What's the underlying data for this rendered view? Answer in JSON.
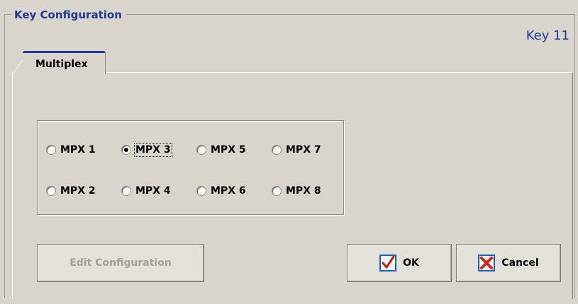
{
  "group": {
    "title": "Key Configuration"
  },
  "key_label": "Key 11",
  "tabs": [
    {
      "label": "Multiplex",
      "selected": true
    }
  ],
  "multiplex": {
    "options": [
      {
        "label": "MPX 1",
        "checked": false
      },
      {
        "label": "MPX 3",
        "checked": true,
        "focused": true
      },
      {
        "label": "MPX 5",
        "checked": false
      },
      {
        "label": "MPX 7",
        "checked": false
      },
      {
        "label": "MPX 2",
        "checked": false
      },
      {
        "label": "MPX 4",
        "checked": false
      },
      {
        "label": "MPX 6",
        "checked": false
      },
      {
        "label": "MPX 8",
        "checked": false
      }
    ]
  },
  "buttons": {
    "edit_config": {
      "label": "Edit Configuration",
      "enabled": false
    },
    "ok": {
      "label": "OK",
      "icon": "checkmark-icon"
    },
    "cancel": {
      "label": "Cancel",
      "icon": "close-x-icon"
    }
  },
  "colors": {
    "title_blue": "#1f3a93",
    "dialog_bg": "#d9d5cc",
    "cancel_red": "#e0201b",
    "ok_blue": "#1565c0"
  }
}
